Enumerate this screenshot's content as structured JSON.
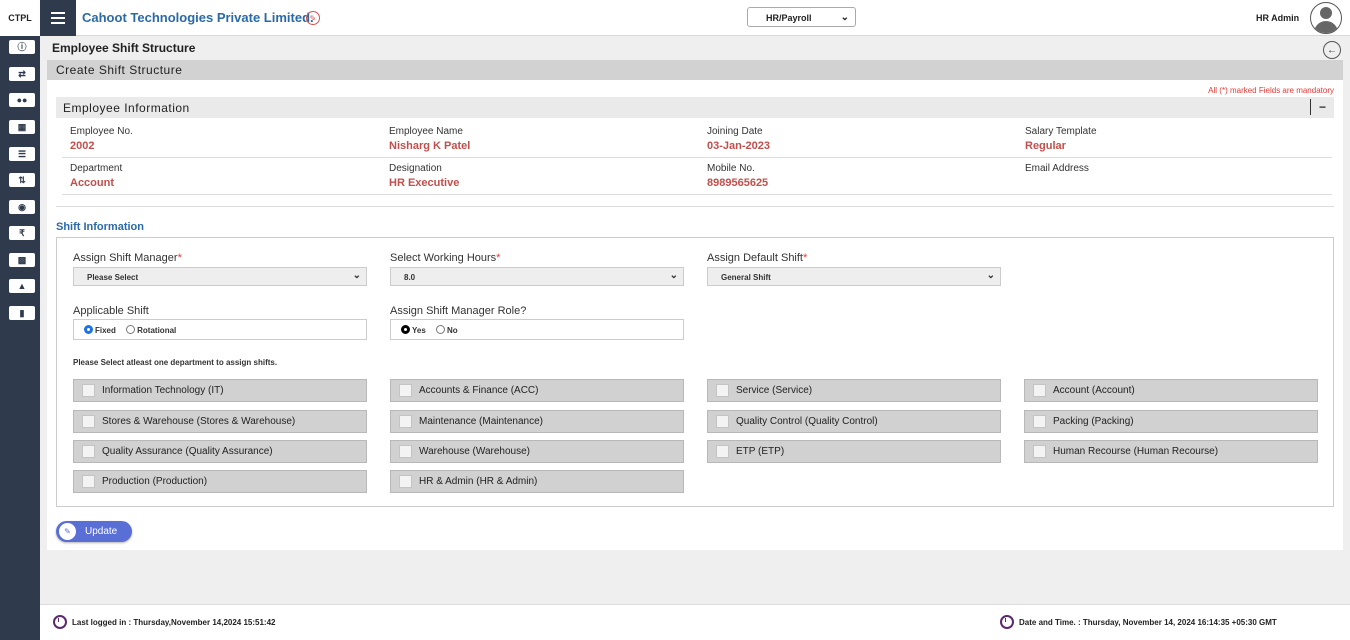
{
  "brand": {
    "code": "CTPL"
  },
  "sidebar": {
    "icons": [
      "dashboard-icon",
      "shuffle-icon",
      "users-icon",
      "calendar-icon",
      "list-icon",
      "sort-icon",
      "cash-icon",
      "rupee-icon",
      "bar-chart-icon",
      "org-chart-icon",
      "bookmark-icon"
    ]
  },
  "header": {
    "company": "Cahoot Technologies Private Limited.",
    "module_selected": "HR/Payroll",
    "user": "HR Admin"
  },
  "page": {
    "title": "Employee Shift Structure",
    "section": "Create Shift Structure"
  },
  "form": {
    "mandatory_note": "All (*) marked Fields are mandatory"
  },
  "employee": {
    "title": "Employee Information",
    "collapse": "−",
    "fields": [
      {
        "label": "Employee No.",
        "value": "2002"
      },
      {
        "label": "Employee Name",
        "value": "Nisharg K Patel"
      },
      {
        "label": "Joining Date",
        "value": "03-Jan-2023"
      },
      {
        "label": "Salary Template",
        "value": "Regular"
      },
      {
        "label": "Department",
        "value": "Account"
      },
      {
        "label": "Designation",
        "value": "HR Executive"
      },
      {
        "label": "Mobile No.",
        "value": "8989565625"
      },
      {
        "label": "Email Address",
        "value": ""
      }
    ]
  },
  "shift": {
    "title": "Shift Information",
    "manager": {
      "label": "Assign Shift Manager",
      "value": "Please Select"
    },
    "hours": {
      "label": "Select Working Hours",
      "value": "8.0"
    },
    "default_shift": {
      "label": "Assign Default Shift",
      "value": "General Shift"
    },
    "applicable": {
      "label": "Applicable Shift",
      "options": [
        "Fixed",
        "Rotational"
      ],
      "selected": "Fixed"
    },
    "role": {
      "label": "Assign Shift Manager Role?",
      "options": [
        "Yes",
        "No"
      ],
      "selected": "Yes"
    },
    "dept_note": "Please Select atleast one department to assign shifts.",
    "departments": [
      "Information Technology (IT)",
      "Accounts & Finance (ACC)",
      "Service (Service)",
      "Account (Account)",
      "Stores & Warehouse (Stores & Warehouse)",
      "Maintenance (Maintenance)",
      "Quality Control (Quality Control)",
      "Packing (Packing)",
      "Quality Assurance (Quality Assurance)",
      "Warehouse (Warehouse)",
      "ETP (ETP)",
      "Human Recourse (Human Recourse)",
      "Production (Production)",
      "HR & Admin (HR & Admin)"
    ]
  },
  "actions": {
    "update": "Update"
  },
  "footer": {
    "last_login": "Last logged in : Thursday,November 14,2024 15:51:42",
    "datetime": "Date and Time. : Thursday, November 14, 2024 16:14:35 +05:30 GMT"
  }
}
